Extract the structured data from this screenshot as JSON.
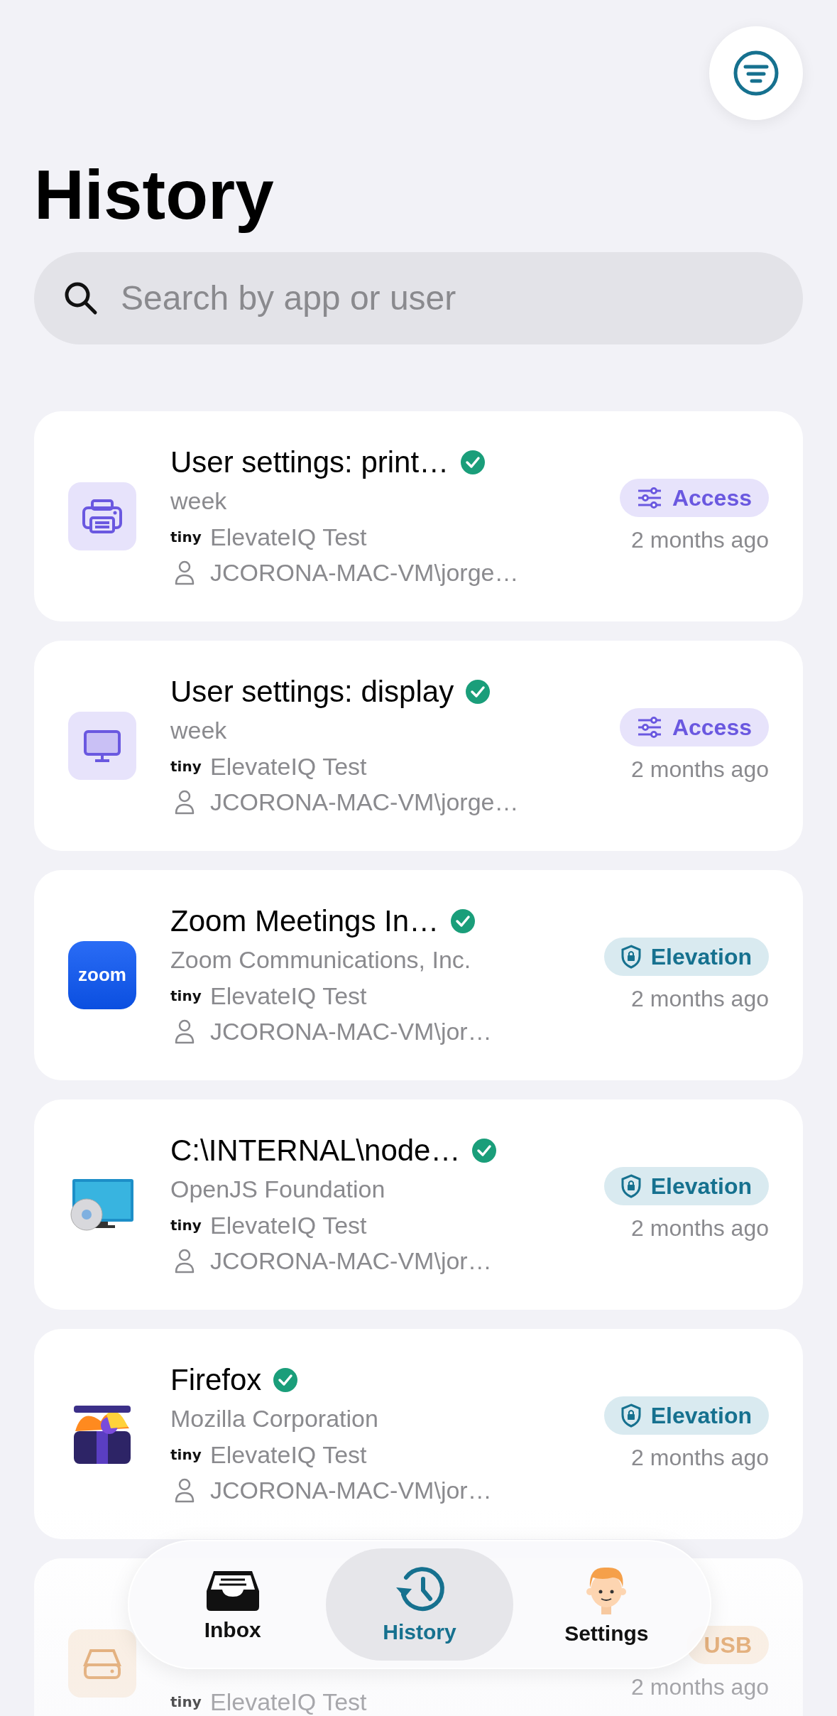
{
  "header": {
    "title": "History"
  },
  "search": {
    "placeholder": "Search by app or user"
  },
  "history": [
    {
      "kind": "printer",
      "title": "User settings: print…",
      "verified": true,
      "subtitle": "week",
      "tenant_logo": "tiny",
      "tenant": "ElevateIQ Test",
      "user": "JCORONA-MAC-VM\\jorge…",
      "badge": {
        "kind": "access",
        "label": "Access"
      },
      "time": "2 months ago"
    },
    {
      "kind": "display",
      "title": "User settings: display",
      "verified": true,
      "subtitle": "week",
      "tenant_logo": "tiny",
      "tenant": "ElevateIQ Test",
      "user": "JCORONA-MAC-VM\\jorge…",
      "badge": {
        "kind": "access",
        "label": "Access"
      },
      "time": "2 months ago"
    },
    {
      "kind": "zoom",
      "icon_text": "zoom",
      "title": "Zoom Meetings In…",
      "verified": true,
      "subtitle": "Zoom Communications, Inc.",
      "tenant_logo": "tiny",
      "tenant": "ElevateIQ Test",
      "user": "JCORONA-MAC-VM\\jor…",
      "badge": {
        "kind": "elevation",
        "label": "Elevation"
      },
      "time": "2 months ago"
    },
    {
      "kind": "installer",
      "title": "C:\\INTERNAL\\node…",
      "verified": true,
      "subtitle": "OpenJS Foundation",
      "tenant_logo": "tiny",
      "tenant": "ElevateIQ Test",
      "user": "JCORONA-MAC-VM\\jor…",
      "badge": {
        "kind": "elevation",
        "label": "Elevation"
      },
      "time": "2 months ago"
    },
    {
      "kind": "firefox",
      "title": "Firefox",
      "verified": true,
      "subtitle": "Mozilla Corporation",
      "tenant_logo": "tiny",
      "tenant": "ElevateIQ Test",
      "user": "JCORONA-MAC-VM\\jor…",
      "badge": {
        "kind": "elevation",
        "label": "Elevation"
      },
      "time": "2 months ago"
    },
    {
      "kind": "drive",
      "tenant_logo": "tiny",
      "tenant": "ElevateIQ Test",
      "badge": {
        "kind": "usb",
        "label": "USB"
      },
      "time": "2 months ago"
    }
  ],
  "tab_bar": [
    {
      "kind": "inbox",
      "label": "Inbox",
      "selected": false
    },
    {
      "kind": "history",
      "label": "History",
      "selected": true
    },
    {
      "kind": "avatar",
      "label": "Settings",
      "selected": false
    }
  ]
}
